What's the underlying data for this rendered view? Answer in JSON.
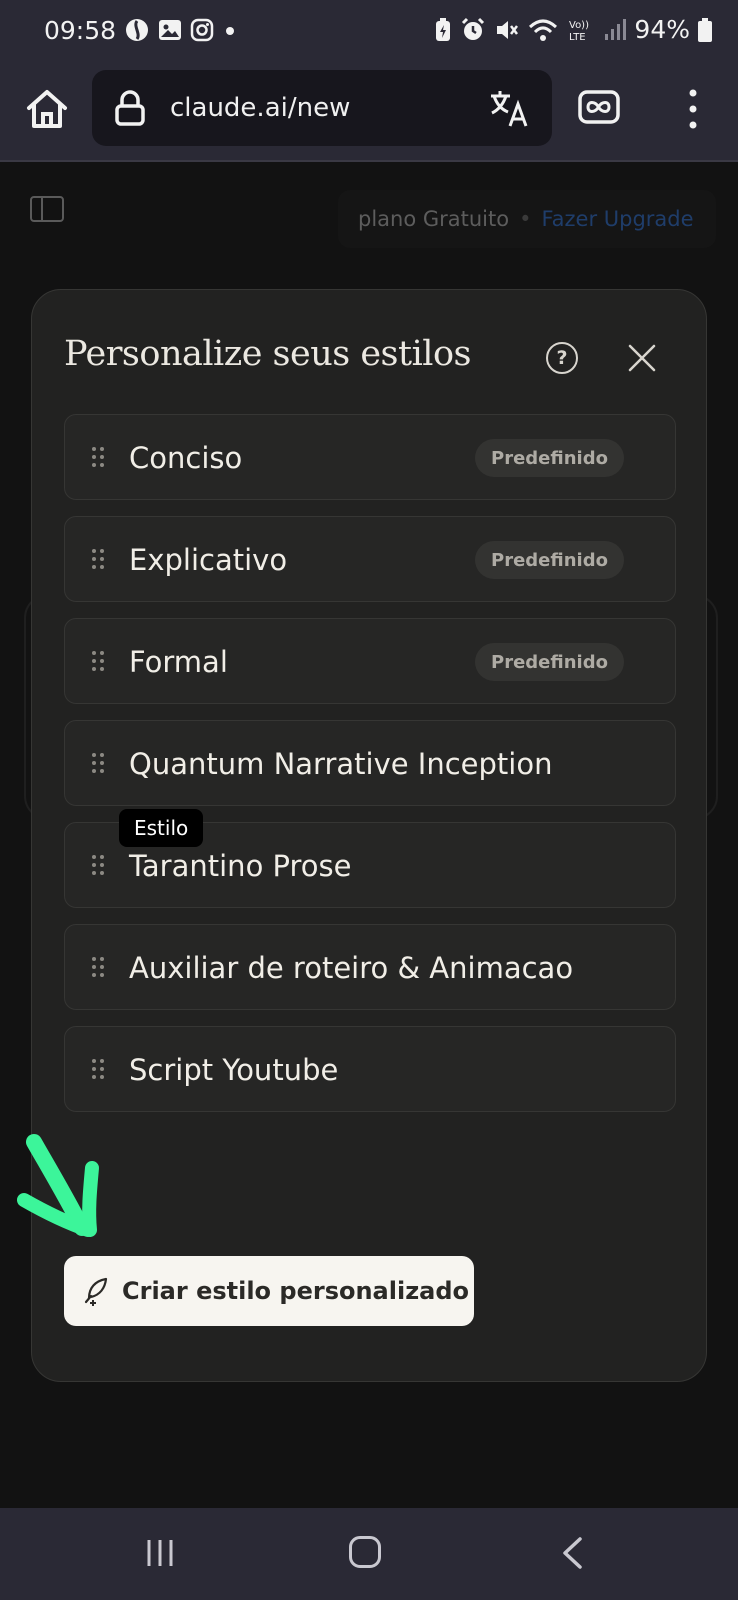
{
  "status_bar": {
    "time": "09:58",
    "battery": "94%"
  },
  "browser": {
    "url": "claude.ai/new"
  },
  "page": {
    "plan_label": "plano Gratuito",
    "upgrade_label": "Fazer Upgrade"
  },
  "modal": {
    "title": "Personalize seus estilos",
    "help_symbol": "?",
    "styles": [
      {
        "name": "Conciso",
        "badge": "Predefinido"
      },
      {
        "name": "Explicativo",
        "badge": "Predefinido"
      },
      {
        "name": "Formal",
        "badge": "Predefinido"
      },
      {
        "name": "Quantum Narrative Inception",
        "badge": ""
      },
      {
        "name": "Tarantino Prose",
        "badge": ""
      },
      {
        "name": "Auxiliar de roteiro & Animacao",
        "badge": ""
      },
      {
        "name": "Script Youtube",
        "badge": ""
      }
    ],
    "tooltip": "Estilo",
    "create_button": "Criar estilo personalizado"
  },
  "colors": {
    "annotation_arrow": "#3cf59a",
    "upgrade_link": "#1f3d6a"
  },
  "icons": {
    "status_left": [
      "threads-icon",
      "gallery-icon",
      "instagram-icon",
      "dot-icon"
    ],
    "status_right": [
      "battery-saver-icon",
      "alarm-icon",
      "mute-icon",
      "wifi-icon",
      "volte-icon",
      "signal-icon",
      "battery-icon"
    ]
  }
}
